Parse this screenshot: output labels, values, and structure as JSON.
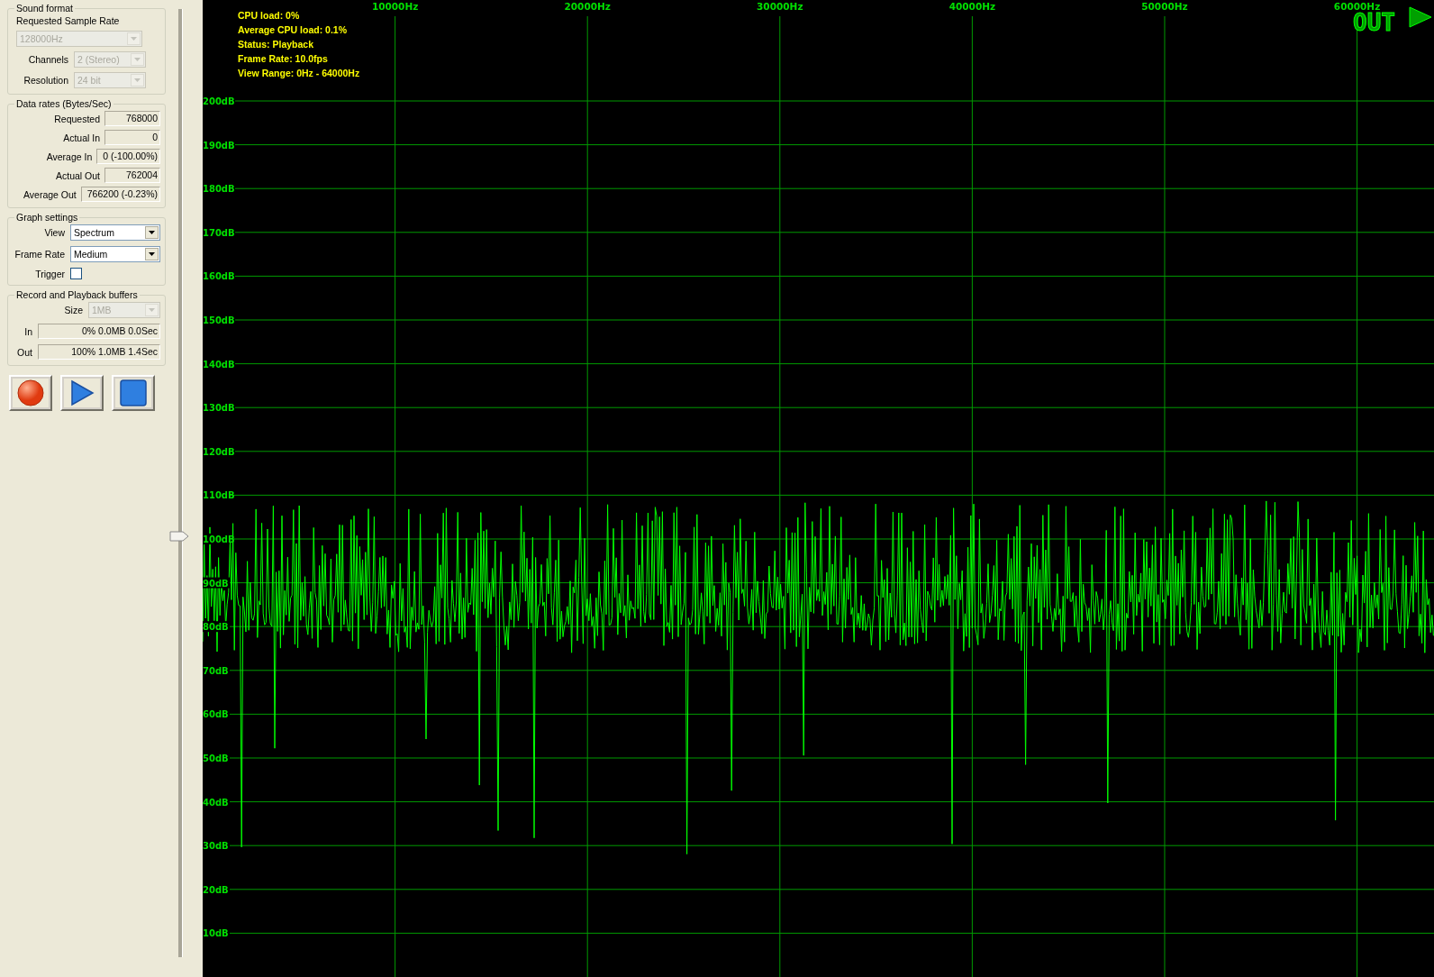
{
  "sound_format": {
    "title": "Sound format",
    "sample_rate_label": "Requested Sample Rate",
    "sample_rate": {
      "value": "128000Hz",
      "disabled": true
    },
    "fields": [
      {
        "label": "Channels",
        "value": "2 (Stereo)",
        "disabled": true
      },
      {
        "label": "Resolution",
        "value": "24 bit",
        "disabled": true
      }
    ]
  },
  "data_rates": {
    "title": "Data rates (Bytes/Sec)",
    "rows": [
      {
        "label": "Requested",
        "value": "768000"
      },
      {
        "label": "Actual In",
        "value": "0"
      },
      {
        "label": "Average In",
        "value": "0 (-100.00%)"
      },
      {
        "label": "Actual Out",
        "value": "762004"
      },
      {
        "label": "Average Out",
        "value": "766200 (-0.23%)"
      }
    ]
  },
  "graph_settings": {
    "title": "Graph settings",
    "fields": [
      {
        "label": "View",
        "value": "Spectrum",
        "disabled": false
      },
      {
        "label": "Frame Rate",
        "value": "Medium",
        "disabled": false
      }
    ],
    "trigger": {
      "label": "Trigger",
      "checked": false
    }
  },
  "buffers": {
    "title": "Record and Playback buffers",
    "size": {
      "label": "Size",
      "value": "1MB",
      "disabled": true
    },
    "rows": [
      {
        "label": "In",
        "value": "0% 0.0MB 0.0Sec"
      },
      {
        "label": "Out",
        "value": "100% 1.0MB 1.4Sec"
      }
    ]
  },
  "transport": [
    {
      "kind": "record"
    },
    {
      "kind": "play"
    },
    {
      "kind": "stop"
    }
  ],
  "gain_slider": {
    "level": 0.45
  },
  "graph": {
    "status": [
      "CPU load: 0%",
      "Average CPU load: 0.1%",
      "Status: Playback",
      "Frame Rate: 10.0fps",
      "View Range: 0Hz - 64000Hz"
    ],
    "indicator": "OUT",
    "x_labels": [
      "10000Hz",
      "20000Hz",
      "30000Hz",
      "40000Hz",
      "50000Hz",
      "60000Hz"
    ],
    "y_labels": [
      "200dB",
      "190dB",
      "180dB",
      "170dB",
      "160dB",
      "150dB",
      "140dB",
      "130dB",
      "120dB",
      "110dB",
      "100dB",
      "90dB",
      "80dB",
      "70dB",
      "60dB",
      "50dB",
      "40dB",
      "30dB",
      "20dB",
      "10dB"
    ]
  }
}
